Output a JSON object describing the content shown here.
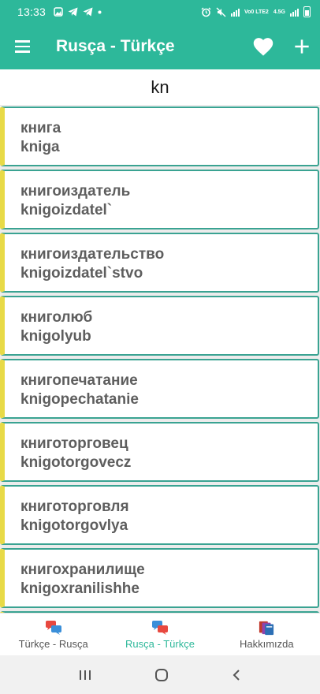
{
  "status_bar": {
    "time": "13:33",
    "network_label": "Vo0 LTE2",
    "network_type": "4.5G"
  },
  "app_bar": {
    "title": "Rusça - Türkçe",
    "icons": [
      "menu-icon",
      "heart-icon",
      "plus-icon"
    ]
  },
  "search": {
    "value": "kn",
    "placeholder": ""
  },
  "results": [
    {
      "russian": "книга",
      "transliteration": "kniga"
    },
    {
      "russian": "книгоиздатель",
      "transliteration": "knigoizdatel`"
    },
    {
      "russian": "книгоиздательство",
      "transliteration": "knigoizdatel`stvo"
    },
    {
      "russian": "книголюб",
      "transliteration": "knigolyub"
    },
    {
      "russian": "книгопечатание",
      "transliteration": "knigopechatanie"
    },
    {
      "russian": "книготорговец",
      "transliteration": "knigotorgovecz"
    },
    {
      "russian": "книготорговля",
      "transliteration": "knigotorgovlya"
    },
    {
      "russian": "книгохранилище",
      "transliteration": "knigoxranilishhe"
    }
  ],
  "bottom_nav": {
    "items": [
      {
        "label": "Türkçe - Rusça",
        "active": false
      },
      {
        "label": "Rusça - Türkçe",
        "active": true
      },
      {
        "label": "Hakkımızda",
        "active": false
      }
    ]
  },
  "colors": {
    "primary": "#2db89a",
    "card_border": "#3aa392",
    "card_accent": "#e8da47",
    "text": "#5e5e5e"
  }
}
